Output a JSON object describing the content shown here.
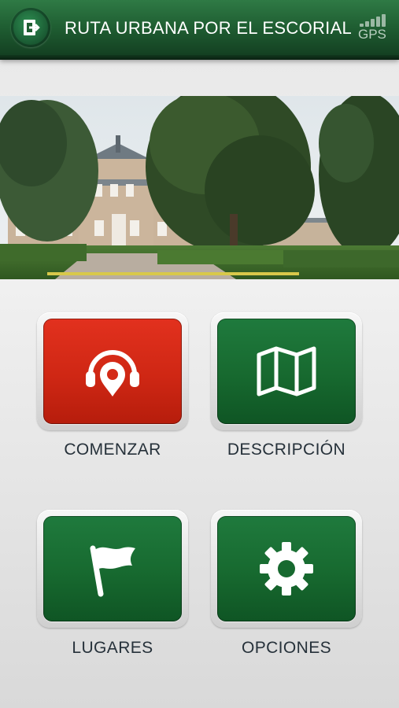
{
  "header": {
    "title": "RUTA URBANA POR EL ESCORIAL",
    "gps_label": "GPS",
    "exit_icon": "exit-door-icon"
  },
  "hero": {
    "image": "palace-gardens-photo"
  },
  "menu": {
    "items": [
      {
        "label": "COMENZAR",
        "icon": "headphones-pin-icon",
        "color": "#d42a17"
      },
      {
        "label": "DESCRIPCIÓN",
        "icon": "folded-map-icon",
        "color": "#17692f"
      },
      {
        "label": "LUGARES",
        "icon": "flag-icon",
        "color": "#17692f"
      },
      {
        "label": "OPCIONES",
        "icon": "gear-icon",
        "color": "#17692f"
      }
    ]
  },
  "colors": {
    "header_green": "#1f5e32",
    "accent_red": "#d42a17",
    "tile_green": "#17692f"
  }
}
